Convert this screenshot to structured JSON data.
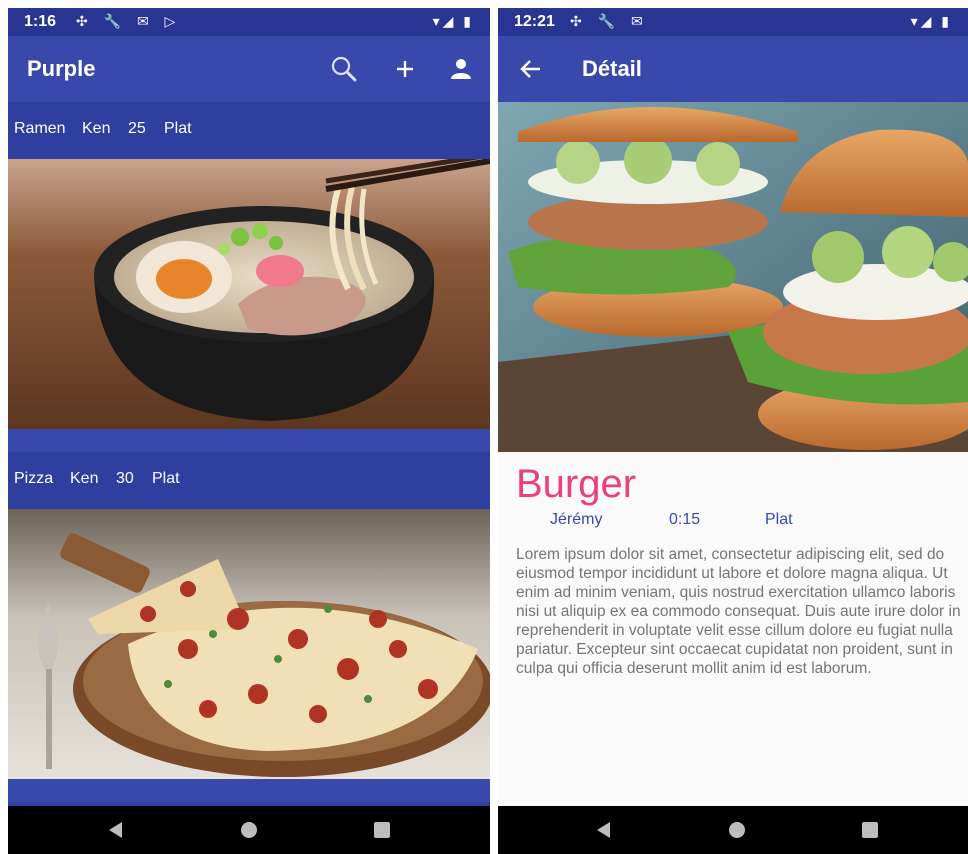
{
  "left_screen": {
    "status": {
      "time": "1:16"
    },
    "appbar": {
      "title": "Purple"
    },
    "items": [
      {
        "name": "Ramen",
        "author": "Ken",
        "time": "25",
        "category": "Plat"
      },
      {
        "name": "Pizza",
        "author": "Ken",
        "time": "30",
        "category": "Plat"
      }
    ]
  },
  "right_screen": {
    "status": {
      "time": "12:21"
    },
    "appbar": {
      "title": "Détail"
    },
    "detail": {
      "name": "Burger",
      "author": "Jérémy",
      "time": "0:15",
      "category": "Plat",
      "description": "Lorem ipsum dolor sit amet, consectetur adipiscing elit, sed do eiusmod tempor incididunt ut labore et dolore magna aliqua. Ut enim ad minim veniam, quis nostrud exercitation ullamco laboris nisi ut aliquip ex ea commodo consequat. Duis aute irure dolor in reprehenderit in voluptate velit esse cillum dolore eu fugiat nulla pariatur. Excepteur sint occaecat cupidatat non proident, sunt in culpa qui officia deserunt mollit anim id est laborum."
    }
  },
  "colors": {
    "primary": "#3949ab",
    "primary_dark": "#283593",
    "accent": "#ec407a"
  }
}
